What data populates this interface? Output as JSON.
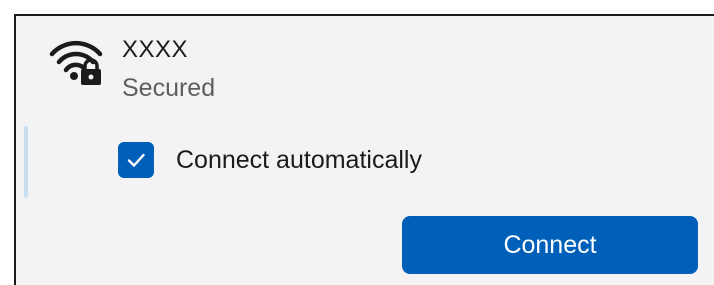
{
  "network": {
    "icon": "wifi-secured-icon",
    "name": "XXXX",
    "status": "Secured"
  },
  "options": {
    "connect_automatically": {
      "label": "Connect automatically",
      "checked": true
    }
  },
  "actions": {
    "connect_label": "Connect"
  },
  "colors": {
    "accent": "#005fb8",
    "panel_background": "#f3f3f3",
    "selection_bar": "#c9def0"
  }
}
